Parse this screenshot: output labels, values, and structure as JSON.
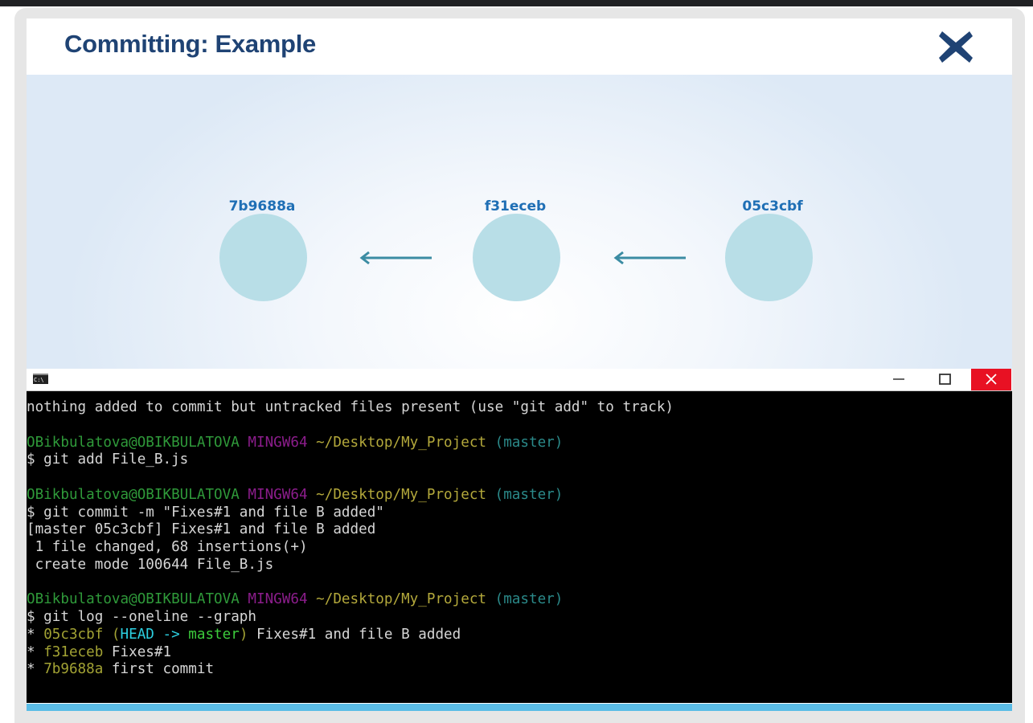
{
  "header": {
    "title": "Committing: Example",
    "close_icon": "close-x-icon",
    "accent": "#1f4374"
  },
  "diagram": {
    "commits": [
      {
        "hash": "7b9688a"
      },
      {
        "hash": "f31eceb"
      },
      {
        "hash": "05c3cbf"
      }
    ],
    "node_color": "#b8dee7",
    "arrow_color": "#3b8ca3"
  },
  "terminal": {
    "window_icon": "cmd-icon",
    "icon_text": "C:\\",
    "controls": {
      "minimize": "minimize-icon",
      "maximize": "maximize-icon",
      "close": "close-icon"
    },
    "lines": [
      [
        {
          "t": "nothing added to commit but untracked files present (use \"git add\" to track)",
          "c": "#d6d6d6"
        }
      ],
      [],
      [
        {
          "t": "OBikbulatova@OBIKBULATOVA ",
          "c": "#2f9a3a"
        },
        {
          "t": "MINGW64 ",
          "c": "#8c1d8c"
        },
        {
          "t": "~/Desktop/My_Project ",
          "c": "#b3a83b"
        },
        {
          "t": "(master)",
          "c": "#2b8a8a"
        }
      ],
      [
        {
          "t": "$ git add File_B.js",
          "c": "#d6d6d6"
        }
      ],
      [],
      [
        {
          "t": "OBikbulatova@OBIKBULATOVA ",
          "c": "#2f9a3a"
        },
        {
          "t": "MINGW64 ",
          "c": "#8c1d8c"
        },
        {
          "t": "~/Desktop/My_Project ",
          "c": "#b3a83b"
        },
        {
          "t": "(master)",
          "c": "#2b8a8a"
        }
      ],
      [
        {
          "t": "$ git commit -m \"Fixes#1 and file B added\"",
          "c": "#d6d6d6"
        }
      ],
      [
        {
          "t": "[master 05c3cbf] Fixes#1 and file B added",
          "c": "#d6d6d6"
        }
      ],
      [
        {
          "t": " 1 file changed, 68 insertions(+)",
          "c": "#d6d6d6"
        }
      ],
      [
        {
          "t": " create mode 100644 File_B.js",
          "c": "#d6d6d6"
        }
      ],
      [],
      [
        {
          "t": "OBikbulatova@OBIKBULATOVA ",
          "c": "#2f9a3a"
        },
        {
          "t": "MINGW64 ",
          "c": "#8c1d8c"
        },
        {
          "t": "~/Desktop/My_Project ",
          "c": "#b3a83b"
        },
        {
          "t": "(master)",
          "c": "#2b8a8a"
        }
      ],
      [
        {
          "t": "$ git log --oneline --graph",
          "c": "#d6d6d6"
        }
      ],
      [
        {
          "t": "* ",
          "c": "#d6d6d6"
        },
        {
          "t": "05c3cbf (",
          "c": "#a3a334"
        },
        {
          "t": "HEAD -> ",
          "c": "#2ccfe0"
        },
        {
          "t": "master",
          "c": "#3ccc3c"
        },
        {
          "t": ")",
          "c": "#a3a334"
        },
        {
          "t": " Fixes#1 and file B added",
          "c": "#d6d6d6"
        }
      ],
      [
        {
          "t": "* ",
          "c": "#d6d6d6"
        },
        {
          "t": "f31eceb",
          "c": "#a3a334"
        },
        {
          "t": " Fixes#1",
          "c": "#d6d6d6"
        }
      ],
      [
        {
          "t": "* ",
          "c": "#d6d6d6"
        },
        {
          "t": "7b9688a",
          "c": "#a3a334"
        },
        {
          "t": " first commit",
          "c": "#d6d6d6"
        }
      ]
    ]
  }
}
